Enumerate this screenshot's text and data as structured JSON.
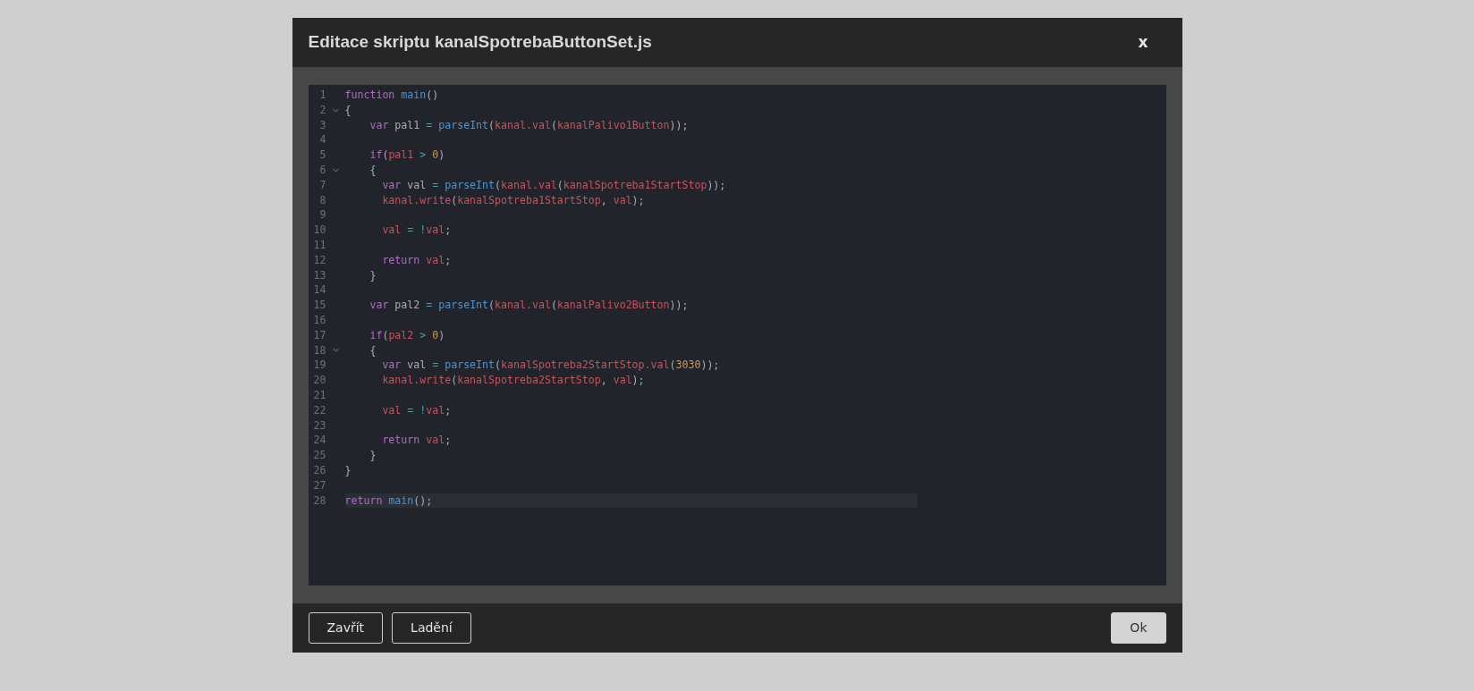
{
  "dialog": {
    "title": "Editace skriptu kanalSpotrebaButtonSet.js",
    "close": "x"
  },
  "editor": {
    "lines": [
      {
        "number": "1",
        "foldable": false,
        "active": false,
        "tokens": [
          {
            "text": "function",
            "kind": "keyword"
          },
          {
            "text": " main",
            "kind": "function"
          },
          {
            "text": "()",
            "kind": "plain"
          }
        ]
      },
      {
        "number": "2",
        "foldable": true,
        "active": false,
        "tokens": [
          {
            "text": "{",
            "kind": "plain"
          }
        ]
      },
      {
        "number": "3",
        "foldable": false,
        "active": false,
        "tokens": [
          {
            "text": "    var",
            "kind": "keyword"
          },
          {
            "text": " pal1 ",
            "kind": "plain"
          },
          {
            "text": "=",
            "kind": "operator"
          },
          {
            "text": " parseInt",
            "kind": "function"
          },
          {
            "text": "(",
            "kind": "plain"
          },
          {
            "text": "kanal.val",
            "kind": "variable"
          },
          {
            "text": "(",
            "kind": "plain"
          },
          {
            "text": "kanalPalivo1Button",
            "kind": "variable"
          },
          {
            "text": "));",
            "kind": "plain"
          }
        ]
      },
      {
        "number": "4",
        "foldable": false,
        "active": false
      },
      {
        "number": "5",
        "foldable": false,
        "active": false,
        "tokens": [
          {
            "text": "    if",
            "kind": "keyword"
          },
          {
            "text": "(",
            "kind": "plain"
          },
          {
            "text": "pal1",
            "kind": "variable"
          },
          {
            "text": " >",
            "kind": "operator"
          },
          {
            "text": " 0",
            "kind": "number"
          },
          {
            "text": ")",
            "kind": "plain"
          }
        ]
      },
      {
        "number": "6",
        "foldable": true,
        "active": false,
        "tokens": [
          {
            "text": "    {",
            "kind": "plain"
          }
        ]
      },
      {
        "number": "7",
        "foldable": false,
        "active": false,
        "tokens": [
          {
            "text": "      var",
            "kind": "keyword"
          },
          {
            "text": " val ",
            "kind": "plain"
          },
          {
            "text": "=",
            "kind": "operator"
          },
          {
            "text": " parseInt",
            "kind": "function"
          },
          {
            "text": "(",
            "kind": "plain"
          },
          {
            "text": "kanal.val",
            "kind": "variable"
          },
          {
            "text": "(",
            "kind": "plain"
          },
          {
            "text": "kanalSpotreba1StartStop",
            "kind": "variable"
          },
          {
            "text": "));",
            "kind": "plain"
          }
        ]
      },
      {
        "number": "8",
        "foldable": false,
        "active": false,
        "tokens": [
          {
            "text": "      kanal.write",
            "kind": "variable"
          },
          {
            "text": "(",
            "kind": "plain"
          },
          {
            "text": "kanalSpotreba1StartStop",
            "kind": "variable"
          },
          {
            "text": ",",
            "kind": "plain"
          },
          {
            "text": " val",
            "kind": "variable"
          },
          {
            "text": ");",
            "kind": "plain"
          }
        ]
      },
      {
        "number": "9",
        "foldable": false,
        "active": false
      },
      {
        "number": "10",
        "foldable": false,
        "active": false,
        "tokens": [
          {
            "text": "      val",
            "kind": "variable"
          },
          {
            "text": " =",
            "kind": "operator"
          },
          {
            "text": " !",
            "kind": "operator"
          },
          {
            "text": "val",
            "kind": "variable"
          },
          {
            "text": ";",
            "kind": "plain"
          }
        ]
      },
      {
        "number": "11",
        "foldable": false,
        "active": false
      },
      {
        "number": "12",
        "foldable": false,
        "active": false,
        "tokens": [
          {
            "text": "      return",
            "kind": "keyword"
          },
          {
            "text": " val",
            "kind": "variable"
          },
          {
            "text": ";",
            "kind": "plain"
          }
        ]
      },
      {
        "number": "13",
        "foldable": false,
        "active": false,
        "tokens": [
          {
            "text": "    }",
            "kind": "plain"
          }
        ]
      },
      {
        "number": "14",
        "foldable": false,
        "active": false
      },
      {
        "number": "15",
        "foldable": false,
        "active": false,
        "tokens": [
          {
            "text": "    var",
            "kind": "keyword"
          },
          {
            "text": " pal2 ",
            "kind": "plain"
          },
          {
            "text": "=",
            "kind": "operator"
          },
          {
            "text": " parseInt",
            "kind": "function"
          },
          {
            "text": "(",
            "kind": "plain"
          },
          {
            "text": "kanal.val",
            "kind": "variable"
          },
          {
            "text": "(",
            "kind": "plain"
          },
          {
            "text": "kanalPalivo2Button",
            "kind": "variable"
          },
          {
            "text": "));",
            "kind": "plain"
          }
        ]
      },
      {
        "number": "16",
        "foldable": false,
        "active": false
      },
      {
        "number": "17",
        "foldable": false,
        "active": false,
        "tokens": [
          {
            "text": "    if",
            "kind": "keyword"
          },
          {
            "text": "(",
            "kind": "plain"
          },
          {
            "text": "pal2",
            "kind": "variable"
          },
          {
            "text": " >",
            "kind": "operator"
          },
          {
            "text": " 0",
            "kind": "number"
          },
          {
            "text": ")",
            "kind": "plain"
          }
        ]
      },
      {
        "number": "18",
        "foldable": true,
        "active": false,
        "tokens": [
          {
            "text": "    {",
            "kind": "plain"
          }
        ]
      },
      {
        "number": "19",
        "foldable": false,
        "active": false,
        "tokens": [
          {
            "text": "      var",
            "kind": "keyword"
          },
          {
            "text": " val ",
            "kind": "plain"
          },
          {
            "text": "=",
            "kind": "operator"
          },
          {
            "text": " parseInt",
            "kind": "function"
          },
          {
            "text": "(",
            "kind": "plain"
          },
          {
            "text": "kanalSpotreba2StartStop.val",
            "kind": "variable"
          },
          {
            "text": "(",
            "kind": "plain"
          },
          {
            "text": "3030",
            "kind": "number"
          },
          {
            "text": "));",
            "kind": "plain"
          }
        ]
      },
      {
        "number": "20",
        "foldable": false,
        "active": false,
        "tokens": [
          {
            "text": "      kanal.write",
            "kind": "variable"
          },
          {
            "text": "(",
            "kind": "plain"
          },
          {
            "text": "kanalSpotreba2StartStop",
            "kind": "variable"
          },
          {
            "text": ",",
            "kind": "plain"
          },
          {
            "text": " val",
            "kind": "variable"
          },
          {
            "text": ");",
            "kind": "plain"
          }
        ]
      },
      {
        "number": "21",
        "foldable": false,
        "active": false
      },
      {
        "number": "22",
        "foldable": false,
        "active": false,
        "tokens": [
          {
            "text": "      val",
            "kind": "variable"
          },
          {
            "text": " =",
            "kind": "operator"
          },
          {
            "text": " !",
            "kind": "operator"
          },
          {
            "text": "val",
            "kind": "variable"
          },
          {
            "text": ";",
            "kind": "plain"
          }
        ]
      },
      {
        "number": "23",
        "foldable": false,
        "active": false
      },
      {
        "number": "24",
        "foldable": false,
        "active": false,
        "tokens": [
          {
            "text": "      return",
            "kind": "keyword"
          },
          {
            "text": " val",
            "kind": "variable"
          },
          {
            "text": ";",
            "kind": "plain"
          }
        ]
      },
      {
        "number": "25",
        "foldable": false,
        "active": false,
        "tokens": [
          {
            "text": "    }",
            "kind": "plain"
          }
        ]
      },
      {
        "number": "26",
        "foldable": false,
        "active": false,
        "tokens": [
          {
            "text": "}",
            "kind": "plain"
          }
        ]
      },
      {
        "number": "27",
        "foldable": false,
        "active": false
      },
      {
        "number": "28",
        "foldable": false,
        "active": true,
        "tokens": [
          {
            "text": "return",
            "kind": "keyword"
          },
          {
            "text": " main",
            "kind": "function"
          },
          {
            "text": "();",
            "kind": "plain"
          }
        ]
      }
    ]
  },
  "footer": {
    "buttons": [
      {
        "label": "Zavřít",
        "kind": "outline"
      },
      {
        "label": "Ladění",
        "kind": "outline"
      },
      {
        "label": "Ok",
        "kind": "primary"
      }
    ]
  }
}
